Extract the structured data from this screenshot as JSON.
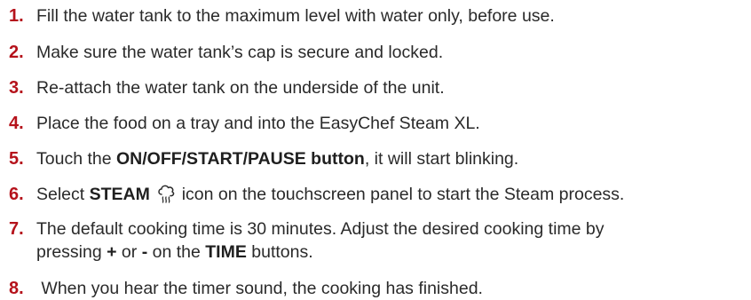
{
  "steps": [
    {
      "num": "1.",
      "text": "Fill the water tank to the maximum level with water only, before use."
    },
    {
      "num": "2.",
      "text": "Make sure the water tank’s cap is secure and locked."
    },
    {
      "num": "3.",
      "text": "Re-attach the water tank on the underside of the unit."
    },
    {
      "num": "4.",
      "text": "Place the food on a tray and into the EasyChef Steam XL."
    },
    {
      "num": "5.",
      "pre": "Touch the ",
      "bold": "ON/OFF/START/PAUSE button",
      "post": ", it will start blinking."
    },
    {
      "num": "6.",
      "pre": "Select ",
      "bold": "STEAM",
      "post": " icon on the touchscreen panel to start the Steam process.",
      "icon": "steam-icon"
    },
    {
      "num": "7.",
      "line1": "The default cooking time is 30 minutes. Adjust the desired cooking time by",
      "line2_pre": "pressing ",
      "plus": "+",
      "or": " or ",
      "minus": "-",
      "on_the": " on the ",
      "time": "TIME",
      "line2_post": " buttons."
    },
    {
      "num": "8.",
      "text": " When you hear the timer sound, the cooking has finished."
    }
  ],
  "colors": {
    "accent": "#b5121b",
    "text": "#2a2a2a"
  }
}
